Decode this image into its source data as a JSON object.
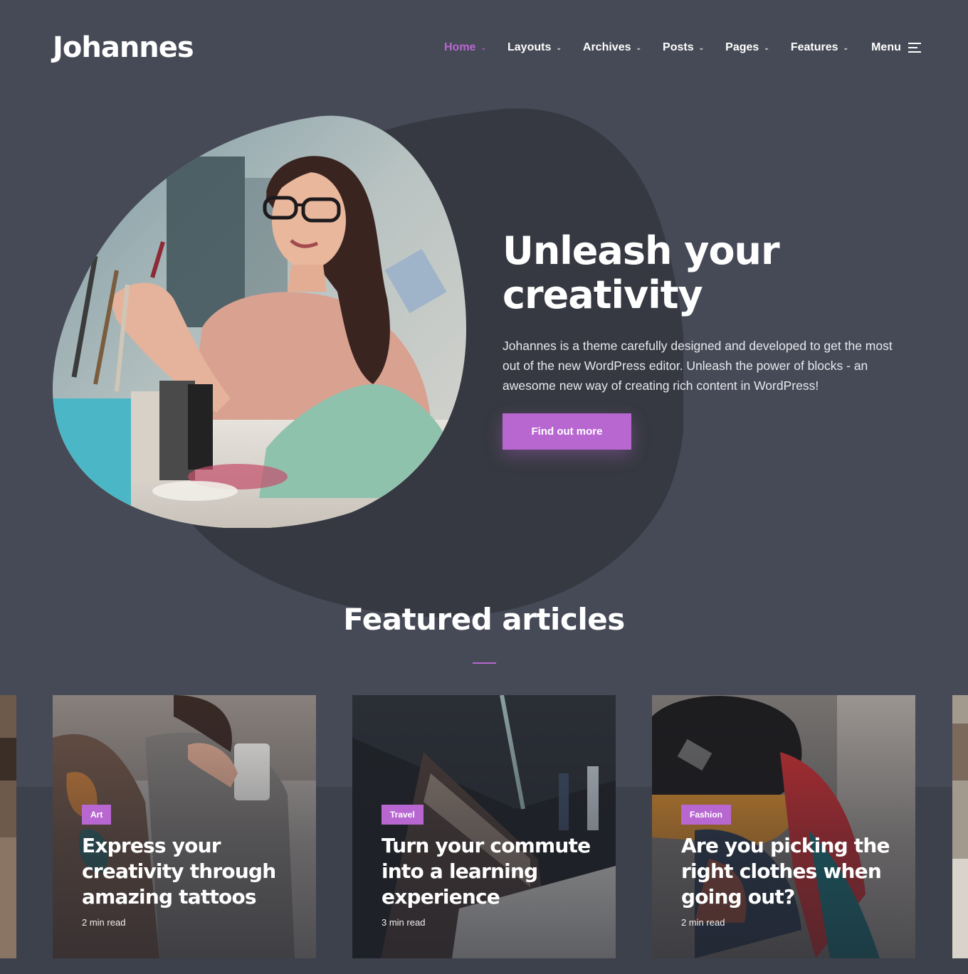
{
  "site": {
    "logo": "Johannes"
  },
  "nav": {
    "items": [
      {
        "label": "Home",
        "active": true
      },
      {
        "label": "Layouts"
      },
      {
        "label": "Archives"
      },
      {
        "label": "Posts"
      },
      {
        "label": "Pages"
      },
      {
        "label": "Features"
      }
    ],
    "menu_label": "Menu",
    "menu_icon": "hamburger-icon",
    "chevron_icon": "chevron-down-icon"
  },
  "hero": {
    "title": "Unleash your\ncreativity",
    "text": "Johannes is a theme carefully designed and developed to get the most out of the new WordPress editor. Unleash the power of blocks - an awesome new way of creating rich content in WordPress!",
    "button": "Find out more"
  },
  "featured": {
    "title": "Featured articles",
    "cards": [
      {
        "tag": "Art",
        "title": "Express your creativity through amazing tattoos",
        "read": "2 min read"
      },
      {
        "tag": "Travel",
        "title": "Turn your commute into a learning experience",
        "read": "3 min read"
      },
      {
        "tag": "Fashion",
        "title": "Are you picking the right clothes when going out?",
        "read": "2 min read"
      }
    ]
  },
  "colors": {
    "background": "#464a56",
    "accent": "#b867d1",
    "blob": "#363941"
  }
}
